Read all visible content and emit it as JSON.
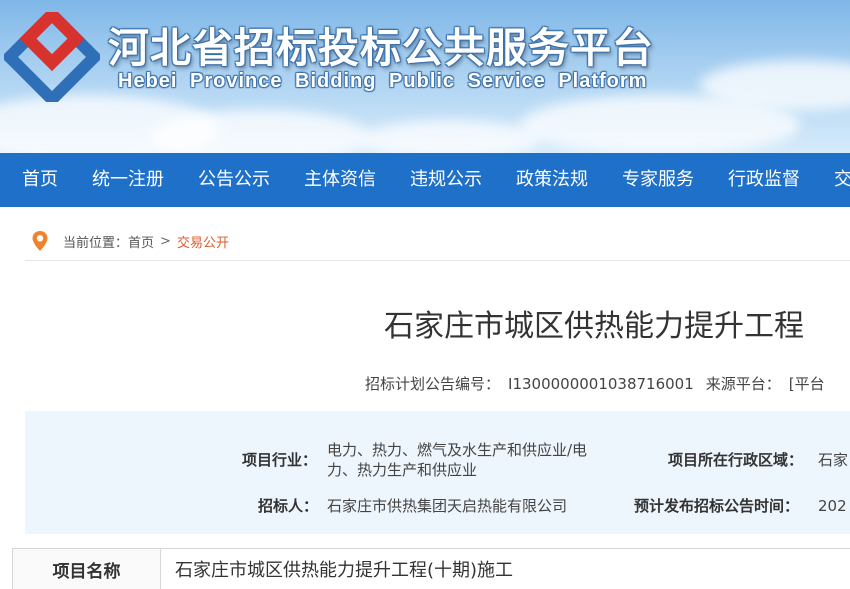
{
  "header": {
    "title_cn": "河北省招标投标公共服务平台",
    "title_en": "Hebei Province Bidding Public Service Platform"
  },
  "nav": {
    "items": [
      "首页",
      "统一注册",
      "公告公示",
      "主体资信",
      "违规公示",
      "政策法规",
      "专家服务",
      "行政监督",
      "交"
    ]
  },
  "breadcrumb": {
    "prefix": "当前位置：",
    "home": "首页",
    "separator": ">",
    "current": "交易公开"
  },
  "notice": {
    "title": "石家庄市城区供热能力提升工程",
    "plan_number_label": "招标计划公告编号：",
    "plan_number": "I1300000001038716001",
    "source_label": "来源平台：",
    "source_value": "[平台"
  },
  "info": {
    "industry_label": "项目行业：",
    "industry_line1": "电力、热力、燃气及水生产和供应业/电",
    "industry_line2": "力、热力生产和供应业",
    "region_label": "项目所在行政区域：",
    "region_value": "石家",
    "tenderer_label": "招标人：",
    "tenderer_value": "石家庄市供热集团天启热能有限公司",
    "publish_time_label": "预计发布招标公告时间：",
    "publish_time_value": "202"
  },
  "table": {
    "project_name_label": "项目名称",
    "project_name_value": "石家庄市城区供热能力提升工程(十期)施工"
  },
  "colors": {
    "nav_bg": "#1f70c9",
    "accent_orange": "#e05b2a",
    "info_bg": "#eef6fd",
    "logo_red": "#d8322e",
    "logo_blue": "#2f6fb8"
  }
}
